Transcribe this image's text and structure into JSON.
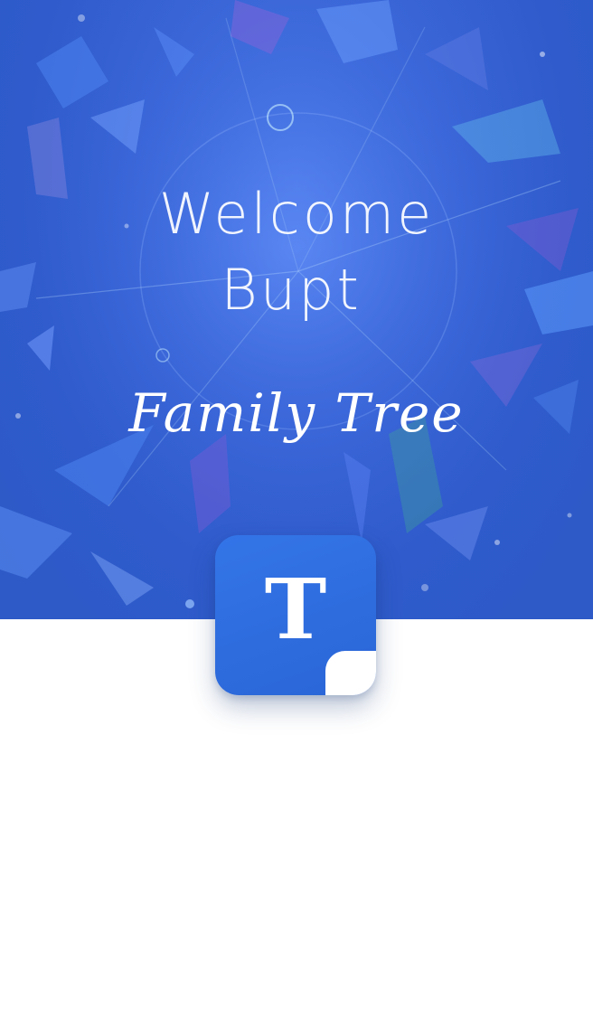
{
  "splash": {
    "title_line1": "Welcome",
    "title_line2": "Bupt",
    "subtitle": "Family Tree",
    "app_icon_letter": "T"
  },
  "colors": {
    "hero_blue": "#2f5bcc",
    "icon_blue": "#2a65d6",
    "background": "#ffffff"
  }
}
